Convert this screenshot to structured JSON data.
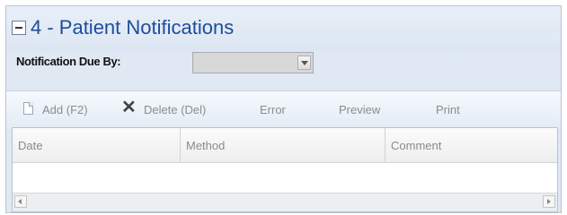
{
  "section": {
    "title": "4 - Patient Notifications",
    "collapse_symbol": "minus-icon"
  },
  "filter": {
    "due_label": "Notification Due By:",
    "due_value": ""
  },
  "toolbar": {
    "add_label": "Add (F2)",
    "delete_label": "Delete (Del)",
    "error_label": "Error",
    "preview_label": "Preview",
    "print_label": "Print"
  },
  "grid": {
    "columns": [
      "Date",
      "Method",
      "Comment"
    ],
    "rows": []
  },
  "colors": {
    "title": "#1d4d9c",
    "panel_bg": "#dfe8f3",
    "disabled_text": "#8c8c8c"
  }
}
